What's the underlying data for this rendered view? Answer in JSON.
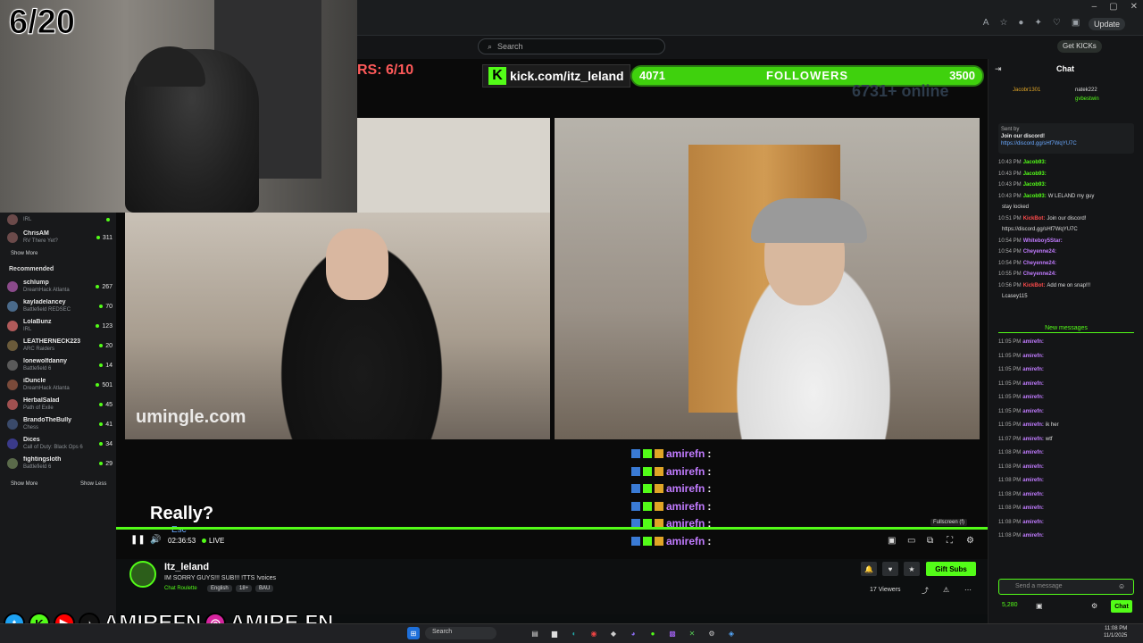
{
  "browser": {
    "update_label": "Update"
  },
  "kick": {
    "search_placeholder": "Search",
    "get_kicks_label": "Get KICKs"
  },
  "overlay": {
    "counter": "6/20",
    "rs_text": "RS: 6/10",
    "kick_url": "kick.com/itz_leland",
    "followers_current": "4071",
    "followers_label": "FOLLOWERS",
    "followers_goal": "3500",
    "online_text": "6731+ online",
    "watermark": "umingle.com",
    "caption": "Really?",
    "caption_hint": "Esc",
    "video_chat": [
      {
        "user": "amirefn",
        "msg": ":"
      },
      {
        "user": "amirefn",
        "msg": ":"
      },
      {
        "user": "amirefn",
        "msg": ":"
      },
      {
        "user": "amirefn",
        "msg": ":"
      },
      {
        "user": "amirefn",
        "msg": ":"
      },
      {
        "user": "amirefn",
        "msg": ":"
      }
    ]
  },
  "sidebar": {
    "following": [
      {
        "name": "",
        "cat": "IRL",
        "count": ""
      },
      {
        "name": "ChrisAM",
        "cat": "RV There Yet?",
        "count": "311"
      }
    ],
    "show_more": "Show More",
    "recommended_heading": "Recommended",
    "recommended": [
      {
        "name": "schlump",
        "cat": "DreamHack Atlanta",
        "count": "267",
        "color": "#8a4a8a"
      },
      {
        "name": "kayladelancey",
        "cat": "Battlefield REDSEC",
        "count": "70",
        "color": "#4a6a8a"
      },
      {
        "name": "LolaBunz",
        "cat": "IRL",
        "count": "123",
        "color": "#b05a5a"
      },
      {
        "name": "LEATHERNECK223",
        "cat": "ARC Raiders",
        "count": "20",
        "color": "#6a5a3a"
      },
      {
        "name": "lonewolfdanny",
        "cat": "Battlefield 6",
        "count": "14",
        "color": "#5a5a5a"
      },
      {
        "name": "iDuncle",
        "cat": "DreamHack Atlanta",
        "count": "501",
        "color": "#7a4a3a"
      },
      {
        "name": "HerbalSalad",
        "cat": "Path of Exile",
        "count": "45",
        "color": "#a05050"
      },
      {
        "name": "BrandoTheBully",
        "cat": "Chess",
        "count": "41",
        "color": "#3a4a6a"
      },
      {
        "name": "Dices",
        "cat": "Call of Duty: Black Ops 6",
        "count": "34",
        "color": "#3a3a8a"
      },
      {
        "name": "fightingsloth",
        "cat": "Battlefield 6",
        "count": "29",
        "color": "#5a6a4a"
      }
    ],
    "show_more_2": "Show More",
    "show_less": "Show Less"
  },
  "player": {
    "time": "02:36:53",
    "live_label": "LIVE",
    "fullscreen_tip": "Fullscreen (f)"
  },
  "stream": {
    "name": "Itz_leland",
    "title": "IM SORRY GUYS!!! SUB!!! !TTS !voices",
    "category": "Chat Roulette",
    "tags": [
      "English",
      "18+",
      "BAU"
    ],
    "gift_subs": "Gift Subs",
    "viewers": "17 Viewers"
  },
  "social": {
    "handle_1": "AMIREFN",
    "handle_2": "AMIRE.FN"
  },
  "chat": {
    "title": "Chat",
    "top_gifters": [
      "Jacobr1301",
      "natek222",
      "gvbestwin"
    ],
    "pinned_from": "Sent by",
    "pinned_text": "Join our discord!",
    "pinned_link": "https://discord.gg/sHf7WqYU7C",
    "messages": [
      {
        "t": "10:43 PM",
        "u": "Jacob93:",
        "m": "",
        "c": "#53fc18"
      },
      {
        "t": "10:43 PM",
        "u": "Jacob93:",
        "m": "",
        "c": "#53fc18"
      },
      {
        "t": "10:43 PM",
        "u": "Jacob93:",
        "m": "",
        "c": "#53fc18"
      },
      {
        "t": "10:43 PM",
        "u": "Jacob93:",
        "m": "W LELAND my guy",
        "c": "#53fc18"
      },
      {
        "t": "",
        "u": "",
        "m": "stay locked",
        "c": "#ddd"
      },
      {
        "t": "10:51 PM",
        "u": "KickBot:",
        "m": "Join our discord!",
        "c": "#ff4b4b"
      },
      {
        "t": "",
        "u": "",
        "m": "https://discord.gg/sHf7WqYU7C",
        "c": "#6aa9ff"
      },
      {
        "t": "10:54 PM",
        "u": "Whiteboy5Star:",
        "m": "",
        "c": "#c17bff"
      },
      {
        "t": "10:54 PM",
        "u": "Cheyenne24:",
        "m": "",
        "c": "#c17bff"
      },
      {
        "t": "10:54 PM",
        "u": "Cheyenne24:",
        "m": "",
        "c": "#c17bff"
      },
      {
        "t": "10:55 PM",
        "u": "Cheyenne24:",
        "m": "",
        "c": "#c17bff"
      },
      {
        "t": "10:56 PM",
        "u": "KickBot:",
        "m": "Add me on snap!!!",
        "c": "#ff4b4b"
      },
      {
        "t": "",
        "u": "",
        "m": "Lcasey115",
        "c": "#ddd"
      }
    ],
    "new_messages_label": "New messages",
    "new_messages": [
      {
        "t": "11:05 PM",
        "u": "amirefn:",
        "m": ""
      },
      {
        "t": "11:05 PM",
        "u": "amirefn:",
        "m": ""
      },
      {
        "t": "11:05 PM",
        "u": "amirefn:",
        "m": ""
      },
      {
        "t": "11:05 PM",
        "u": "amirefn:",
        "m": ""
      },
      {
        "t": "11:05 PM",
        "u": "amirefn:",
        "m": ""
      },
      {
        "t": "11:05 PM",
        "u": "amirefn:",
        "m": ""
      },
      {
        "t": "11:05 PM",
        "u": "amirefn:",
        "m": "ik her"
      },
      {
        "t": "11:07 PM",
        "u": "amirefn:",
        "m": "wtf"
      },
      {
        "t": "11:08 PM",
        "u": "amirefn:",
        "m": ""
      },
      {
        "t": "11:08 PM",
        "u": "amirefn:",
        "m": ""
      },
      {
        "t": "11:08 PM",
        "u": "amirefn:",
        "m": ""
      },
      {
        "t": "11:08 PM",
        "u": "amirefn:",
        "m": ""
      },
      {
        "t": "11:08 PM",
        "u": "amirefn:",
        "m": ""
      },
      {
        "t": "11:08 PM",
        "u": "amirefn:",
        "m": ""
      },
      {
        "t": "11:08 PM",
        "u": "amirefn:",
        "m": ""
      }
    ],
    "input_placeholder": "Send a message",
    "kicks_balance": "5,280",
    "send_label": "Chat"
  },
  "taskbar": {
    "search_label": "Search",
    "time": "11:08 PM",
    "date": "11/1/2025"
  },
  "colors": {
    "kick_green": "#53fc18",
    "chat_purple": "#c17bff"
  }
}
